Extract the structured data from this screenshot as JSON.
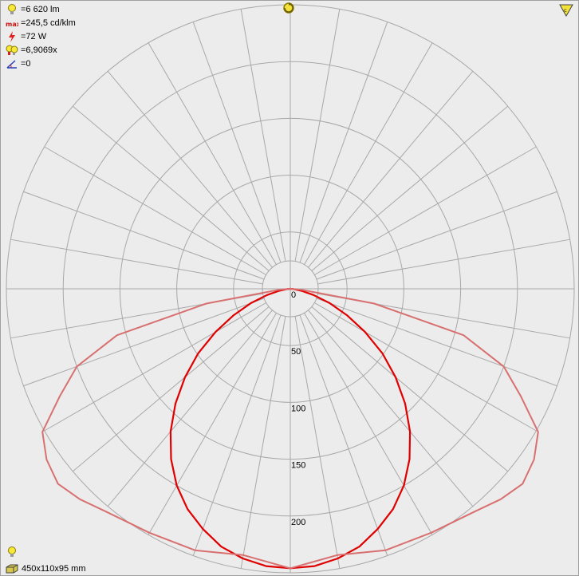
{
  "info": {
    "flux": "=6 620 lm",
    "max_intensity": "=245,5 cd/klm",
    "power": "=72 W",
    "lor": "=6,9069x",
    "tilt": "=0"
  },
  "dimensions": "450x110x95 mm",
  "icons": {
    "flux": "bulb-icon",
    "max": "max-icon",
    "power": "lightning-icon",
    "lor": "bulb-multi-icon",
    "tilt": "angle-icon",
    "rotate": "rotate-icon",
    "corner": "warning-icon",
    "bottom_bulb": "bulb-icon",
    "box": "box-icon"
  },
  "colors": {
    "background": "#ececec",
    "grid": "#a8a8a8",
    "c0_curve": "#e00000",
    "c90_curve": "#d87070"
  },
  "chart_data": {
    "type": "polar",
    "radial_ticks": [
      0,
      50,
      100,
      150,
      200,
      250
    ],
    "rmax": 250,
    "angle_step_deg": 10,
    "series": [
      {
        "color": "#e00000",
        "angles": [
          0,
          5,
          10,
          15,
          20,
          25,
          30,
          35,
          40,
          45,
          50,
          55,
          60,
          65,
          70,
          75,
          80,
          85,
          90
        ],
        "values": [
          246,
          245,
          241,
          235,
          225,
          214,
          200,
          183,
          164,
          143,
          121,
          99,
          76,
          55,
          37,
          21,
          10,
          3,
          0
        ]
      },
      {
        "color": "#d87070",
        "angles": [
          0,
          10,
          20,
          30,
          40,
          45,
          50,
          55,
          60,
          65,
          70,
          75,
          80,
          85,
          90
        ],
        "values": [
          246,
          238,
          245,
          248,
          255,
          262,
          267,
          262,
          252,
          224,
          200,
          158,
          75,
          10,
          0
        ]
      }
    ]
  }
}
